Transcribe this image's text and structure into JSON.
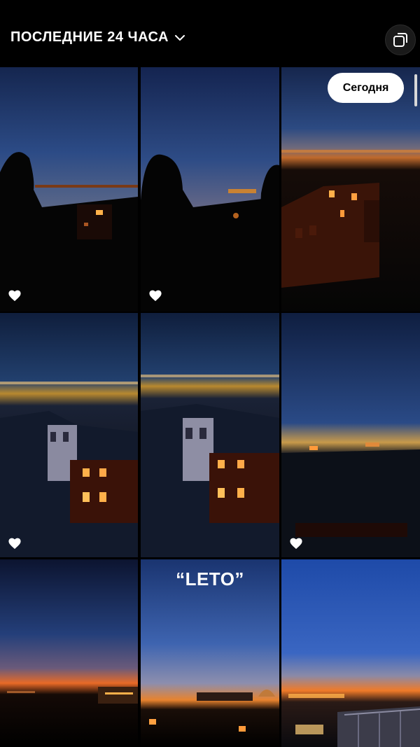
{
  "header": {
    "title": "ПОСЛЕДНИЕ 24 ЧАСА",
    "title_icon": "chevron-down-icon",
    "multi_select_icon": "copy-stack-icon"
  },
  "today_button": {
    "label": "Сегодня"
  },
  "photos": [
    {
      "name": "photo-1",
      "liked": true,
      "scene": "sunset-silhouette"
    },
    {
      "name": "photo-2",
      "liked": true,
      "scene": "sunset-silhouette-blur"
    },
    {
      "name": "photo-3",
      "liked": false,
      "scene": "night-building"
    },
    {
      "name": "photo-4",
      "liked": true,
      "scene": "rooftops-night"
    },
    {
      "name": "photo-5",
      "liked": false,
      "scene": "rooftops-night"
    },
    {
      "name": "photo-6",
      "liked": true,
      "scene": "skyline-dusk"
    },
    {
      "name": "photo-7",
      "liked": false,
      "scene": "sunset-city"
    },
    {
      "name": "photo-8",
      "liked": false,
      "scene": "sunset-city",
      "text_overlay": "“LETO”"
    },
    {
      "name": "photo-9",
      "liked": false,
      "scene": "sunset-rooftop"
    }
  ],
  "colors": {
    "background": "#000000",
    "button_bg": "#ffffff",
    "text": "#ffffff"
  }
}
